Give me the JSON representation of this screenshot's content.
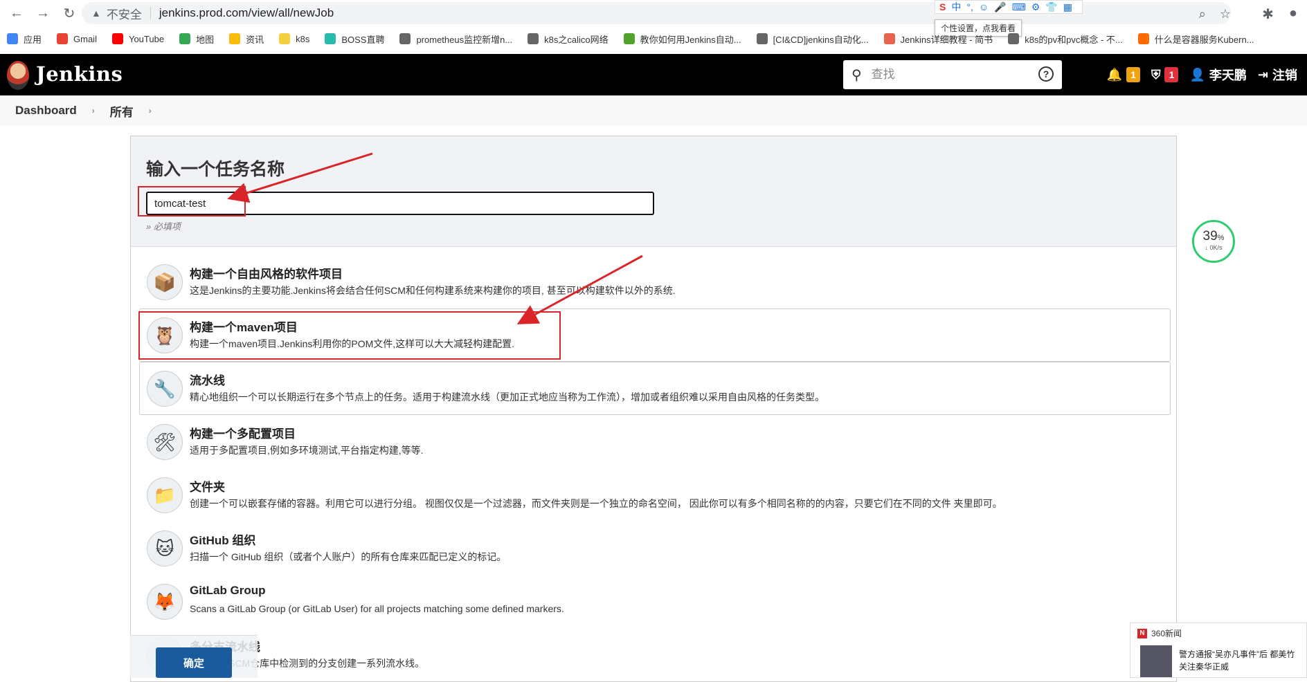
{
  "browser": {
    "insecure_label": "不安全",
    "url": "jenkins.prod.com/view/all/newJob",
    "ime_tip": "个性设置，点我看看",
    "ime_items": [
      "中",
      "°,",
      "☺",
      "🎤",
      "⌨",
      "⚙",
      "👕",
      "▦"
    ]
  },
  "bookmarks": [
    {
      "label": "应用",
      "color": "#4285f4"
    },
    {
      "label": "Gmail",
      "color": "#ea4335"
    },
    {
      "label": "YouTube",
      "color": "#ff0000"
    },
    {
      "label": "地图",
      "color": "#34a853"
    },
    {
      "label": "资讯",
      "color": "#fbbc05"
    },
    {
      "label": "k8s",
      "color": "#f4d03f"
    },
    {
      "label": "BOSS直聘",
      "color": "#2bbbad"
    },
    {
      "label": "prometheus监控新增n...",
      "color": "#666666"
    },
    {
      "label": "k8s之calico网络",
      "color": "#666666"
    },
    {
      "label": "教你如何用Jenkins自动...",
      "color": "#52a32c"
    },
    {
      "label": "[CI&CD]jenkins自动化...",
      "color": "#666666"
    },
    {
      "label": "Jenkins详细教程 - 简书",
      "color": "#e9644f"
    },
    {
      "label": "k8s的pv和pvc概念 - 不...",
      "color": "#666666"
    },
    {
      "label": "什么是容器服务Kubern...",
      "color": "#ff6a00"
    }
  ],
  "header": {
    "brand": "Jenkins",
    "search_placeholder": "查找",
    "help": "?",
    "notifications_count": "1",
    "security_count": "1",
    "user": "李天鹏",
    "logout": "注销"
  },
  "breadcrumb": [
    "Dashboard",
    "所有"
  ],
  "form": {
    "title": "输入一个任务名称",
    "name_value": "tomcat-test",
    "required_note": "» 必填项",
    "ok_button": "确定"
  },
  "item_types": [
    {
      "title": "构建一个自由风格的软件项目",
      "desc": "这是Jenkins的主要功能.Jenkins将会结合任何SCM和任何构建系统来构建你的项目, 甚至可以构建软件以外的系统.",
      "icon": "📦"
    },
    {
      "title": "构建一个maven项目",
      "desc": "构建一个maven项目.Jenkins利用你的POM文件,这样可以大大减轻构建配置.",
      "icon": "🦉"
    },
    {
      "title": "流水线",
      "desc": "精心地组织一个可以长期运行在多个节点上的任务。适用于构建流水线（更加正式地应当称为工作流），增加或者组织难以采用自由风格的任务类型。",
      "icon": "🔧"
    },
    {
      "title": "构建一个多配置项目",
      "desc": "适用于多配置项目,例如多环境测试,平台指定构建,等等.",
      "icon": "🛠"
    },
    {
      "title": "文件夹",
      "desc": "创建一个可以嵌套存储的容器。利用它可以进行分组。 视图仅仅是一个过滤器，而文件夹则是一个独立的命名空间， 因此你可以有多个相同名称的的内容，只要它们在不同的文件 夹里即可。",
      "icon": "📁"
    },
    {
      "title": "GitHub 组织",
      "desc": "扫描一个 GitHub 组织（或者个人账户）的所有仓库来匹配已定义的标记。",
      "icon": "🐱"
    },
    {
      "title": "GitLab Group",
      "desc": "Scans a GitLab Group (or GitLab User) for all projects matching some defined markers.",
      "icon": "🦊"
    },
    {
      "title": "多分支流水线",
      "desc": "根据一个SCM仓库中检测到的分支创建一系列流水线。",
      "icon": "⑂"
    }
  ],
  "speed_meter": {
    "percent": "39",
    "percent_sign": "%",
    "rate": "↓ 0K/s"
  },
  "news": {
    "source": "360新闻",
    "line1": "警方通报“吴亦凡事件”后 都美竹",
    "line2": "关注秦华正威"
  },
  "colors": {
    "highlight": "#d9252a",
    "ok_button": "#1a5b9e",
    "header_bg": "#000000"
  }
}
